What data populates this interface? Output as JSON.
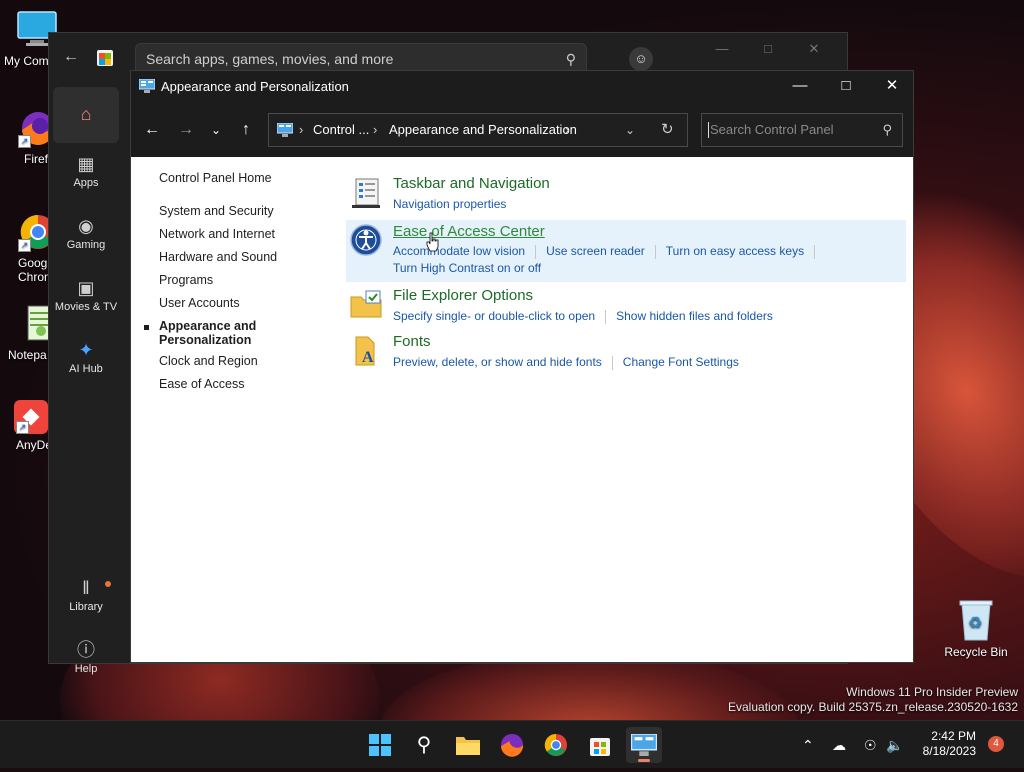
{
  "desktop": {
    "icons": [
      {
        "label": "My Com",
        "icon": "monitor-icon"
      },
      {
        "label": "Firefo",
        "icon": "firefox-icon"
      },
      {
        "label": "Goog",
        "label2": "Chron",
        "icon": "chrome-icon"
      },
      {
        "label": "Notepa",
        "icon": "notepad-icon"
      },
      {
        "label": "AnyDe",
        "icon": "anydesk-icon"
      }
    ],
    "recycle_bin": "Recycle Bin",
    "watermark_line1": "Windows 11 Pro Insider Preview",
    "watermark_line2": "Evaluation copy. Build 25375.zn_release.230520-1632"
  },
  "store": {
    "search_placeholder": "Search apps, games, movies, and more",
    "nav": [
      {
        "label": "",
        "icon": "home-icon",
        "active": true
      },
      {
        "label": "Apps",
        "icon": "apps-icon"
      },
      {
        "label": "Gaming",
        "icon": "gamepad-icon"
      },
      {
        "label": "Movies & TV",
        "icon": "movies-icon"
      },
      {
        "label": "AI Hub",
        "icon": "sparkle-icon"
      },
      {
        "label": "Library",
        "icon": "library-icon"
      },
      {
        "label": "Help",
        "icon": "help-icon"
      }
    ]
  },
  "control_panel": {
    "title": "Appearance and Personalization",
    "address": {
      "crumbs": [
        "Control ...",
        "Appearance and Personalization"
      ]
    },
    "search_placeholder": "Search Control Panel",
    "left_nav": {
      "home": "Control Panel Home",
      "items": [
        "System and Security",
        "Network and Internet",
        "Hardware and Sound",
        "Programs",
        "User Accounts"
      ],
      "active_line1": "Appearance and",
      "active_line2": "Personalization",
      "items_after": [
        "Clock and Region",
        "Ease of Access"
      ]
    },
    "categories": [
      {
        "title": "Taskbar and Navigation",
        "icon": "taskbar-icon",
        "links": [
          "Navigation properties"
        ]
      },
      {
        "title": "Ease of Access Center",
        "icon": "ease-of-access-icon",
        "links": [
          "Accommodate low vision",
          "Use screen reader",
          "Turn on easy access keys"
        ],
        "links_row2": [
          "Turn High Contrast on or off"
        ],
        "highlighted": true
      },
      {
        "title": "File Explorer Options",
        "icon": "folder-options-icon",
        "links": [
          "Specify single- or double-click to open",
          "Show hidden files and folders"
        ]
      },
      {
        "title": "Fonts",
        "icon": "fonts-icon",
        "links": [
          "Preview, delete, or show and hide fonts",
          "Change Font Settings"
        ]
      }
    ]
  },
  "taskbar": {
    "apps": [
      "start-icon",
      "search-icon",
      "file-explorer-icon",
      "firefox-icon",
      "chrome-icon",
      "store-icon",
      "control-panel-icon"
    ],
    "time": "2:42 PM",
    "date": "8/18/2023",
    "notification_count": "4"
  }
}
